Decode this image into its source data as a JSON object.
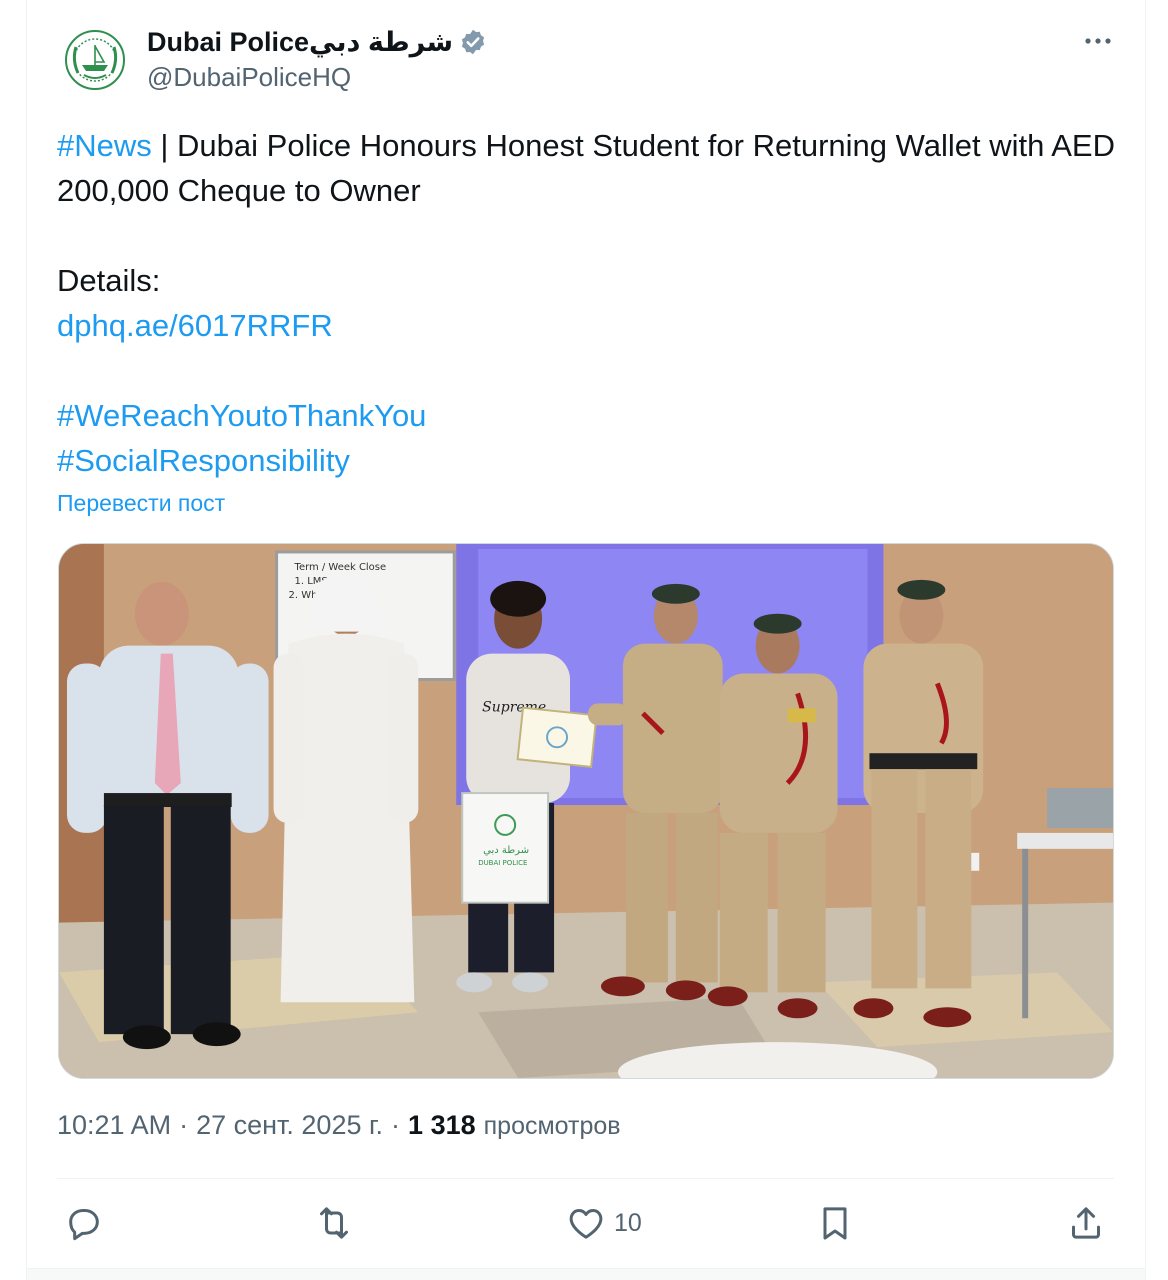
{
  "author": {
    "display_name": "Dubai Policeشرطة دبي",
    "handle": "@DubaiPoliceHQ",
    "verified": true
  },
  "post": {
    "hashtag_news": "#News",
    "headline_rest": " | Dubai Police Honours Honest Student for Returning Wallet with AED 200,000 Cheque to Owner",
    "details_label": "Details:",
    "link": "dphq.ae/6017RRFR",
    "hashtag_thanks": "#WeReachYoutoThankYou",
    "hashtag_social": "#SocialResponsibility",
    "translate_label": "Перевести пост"
  },
  "media": {
    "whiteboard_text_1": "Term / Week Close",
    "whiteboard_text_2": "1. LMS",
    "whiteboard_text_3": "2. Wh",
    "bag_text": "شرطة دبي",
    "bag_text_2": "DUBAI POLICE",
    "sweater_text": "Supreme"
  },
  "meta": {
    "time": "10:21 AM",
    "separator": "·",
    "date": "27 сент. 2025 г.",
    "separator2": "·",
    "views_count": "1 318",
    "views_label": "просмотров"
  },
  "actions": {
    "like_count": "10"
  },
  "colors": {
    "link": "#1d9bf0",
    "muted": "#536471",
    "verified": "#829aab"
  },
  "icons": [
    "more-icon",
    "verified-badge-icon",
    "reply-icon",
    "retweet-icon",
    "like-icon",
    "bookmark-icon",
    "share-icon"
  ]
}
